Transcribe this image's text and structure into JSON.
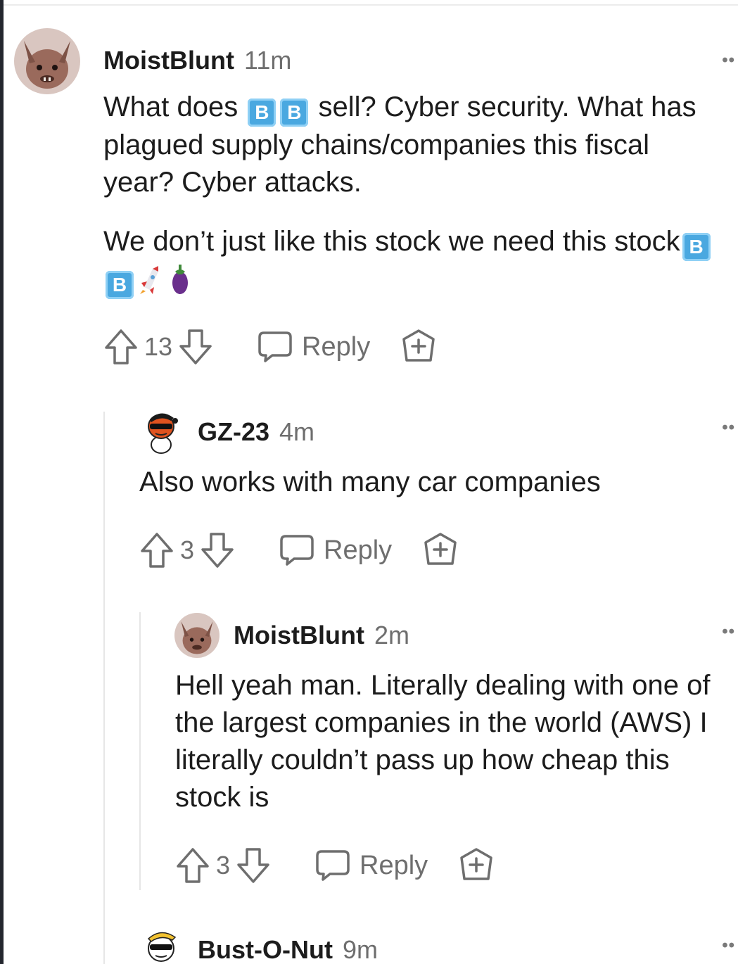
{
  "comments": [
    {
      "author": "MoistBlunt",
      "time": "11m",
      "paragraphs": [
        {
          "before": "What does ",
          "emoji1": "B",
          "emoji2": "B",
          "after": " sell? Cyber security. What has plagued supply chains/companies this fiscal year? Cyber attacks."
        },
        {
          "before": "We don’t just like this stock we need this stock",
          "emoji1": "B",
          "emoji2": "B",
          "after": ""
        }
      ],
      "emoji_icons": [
        "rocket-emoji",
        "eggplant-emoji"
      ],
      "votes": "13",
      "reply_label": "Reply",
      "more": "••"
    },
    {
      "author": "GZ-23",
      "time": "4m",
      "text": "Also works with many car companies",
      "votes": "3",
      "reply_label": "Reply",
      "more": "••"
    },
    {
      "author": "MoistBlunt",
      "time": "2m",
      "text": "Hell yeah man. Literally dealing with one of the largest companies in the world (AWS) I literally couldn’t pass up how cheap this stock is",
      "votes": "3",
      "reply_label": "Reply",
      "more": "••"
    },
    {
      "author": "Bust-O-Nut",
      "time": "9m",
      "more": "••"
    }
  ],
  "colors": {
    "text": "#1c1c1c",
    "muted": "#6e6e6e",
    "thread_line": "#e6e6e6",
    "emoji_b": "#4aa8e0"
  }
}
